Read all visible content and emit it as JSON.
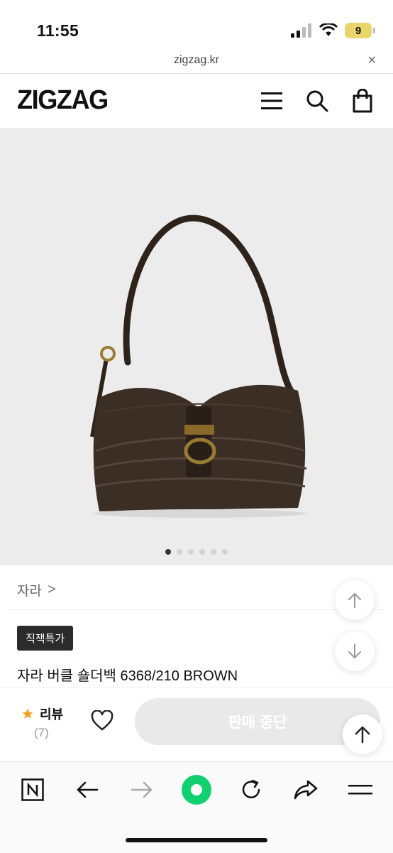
{
  "status_bar": {
    "time": "11:55",
    "battery": "9"
  },
  "browser": {
    "url": "zigzag.kr",
    "close_label": "×"
  },
  "header": {
    "logo": "ZIGZAG"
  },
  "product": {
    "brand": "자라",
    "brand_chevron": ">",
    "badge": "직잭특가",
    "title": "자라 버클 숄더백 6368/210 BROWN",
    "image_dots": 6,
    "active_dot": 0
  },
  "actions": {
    "review_label": "리뷰",
    "review_count": "(7)",
    "sold_out_label": "판매 중단"
  },
  "colors": {
    "accent_star": "#f0a020",
    "toggle_green": "#10d070",
    "bag_brown": "#3b2e24"
  }
}
